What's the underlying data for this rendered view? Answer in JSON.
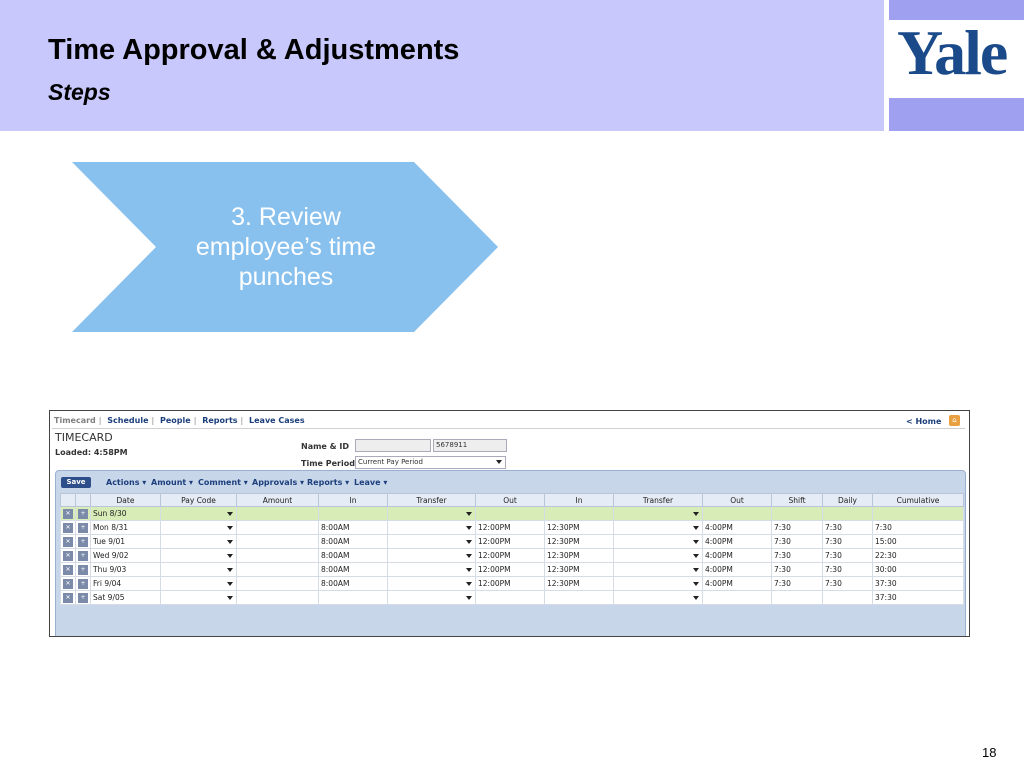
{
  "slide": {
    "title": "Time Approval & Adjustments",
    "subtitle": "Steps",
    "logo": "Yale",
    "step": "3.  Review employee’s time punches",
    "page_number": "18",
    "colors": {
      "header_band": "#c8c8fc",
      "logo_band": "#a0a0f0",
      "chevron": "#88c0ee",
      "logo_text": "#1a4a8a"
    }
  },
  "app": {
    "nav": [
      "Timecard",
      "Schedule",
      "People",
      "Reports",
      "Leave Cases"
    ],
    "home_link": "< Home",
    "heading": "TIMECARD",
    "loaded": "Loaded: 4:58PM",
    "name_id_label": "Name & ID",
    "name_value": "",
    "id_value": "5678911",
    "time_period_label": "Time Period",
    "time_period_value": "Current Pay Period",
    "save_label": "Save",
    "menus": [
      "Actions",
      "Amount",
      "Comment",
      "Approvals",
      "Reports",
      "Leave"
    ],
    "columns": [
      "Date",
      "Pay Code",
      "Amount",
      "In",
      "Transfer",
      "Out",
      "In",
      "Transfer",
      "Out",
      "Shift",
      "Daily",
      "Cumulative"
    ],
    "rows": [
      {
        "date": "Sun 8/30",
        "in1": "",
        "out1": "",
        "in2": "",
        "out2": "",
        "shift": "",
        "daily": "",
        "cum": ""
      },
      {
        "date": "Mon 8/31",
        "in1": "8:00AM",
        "out1": "12:00PM",
        "in2": "12:30PM",
        "out2": "4:00PM",
        "shift": "7:30",
        "daily": "7:30",
        "cum": "7:30"
      },
      {
        "date": "Tue 9/01",
        "in1": "8:00AM",
        "out1": "12:00PM",
        "in2": "12:30PM",
        "out2": "4:00PM",
        "shift": "7:30",
        "daily": "7:30",
        "cum": "15:00"
      },
      {
        "date": "Wed 9/02",
        "in1": "8:00AM",
        "out1": "12:00PM",
        "in2": "12:30PM",
        "out2": "4:00PM",
        "shift": "7:30",
        "daily": "7:30",
        "cum": "22:30"
      },
      {
        "date": "Thu 9/03",
        "in1": "8:00AM",
        "out1": "12:00PM",
        "in2": "12:30PM",
        "out2": "4:00PM",
        "shift": "7:30",
        "daily": "7:30",
        "cum": "30:00"
      },
      {
        "date": "Fri 9/04",
        "in1": "8:00AM",
        "out1": "12:00PM",
        "in2": "12:30PM",
        "out2": "4:00PM",
        "shift": "7:30",
        "daily": "7:30",
        "cum": "37:30"
      },
      {
        "date": "Sat 9/05",
        "in1": "",
        "out1": "",
        "in2": "",
        "out2": "",
        "shift": "",
        "daily": "",
        "cum": "37:30"
      }
    ],
    "highlight_row": 0
  }
}
